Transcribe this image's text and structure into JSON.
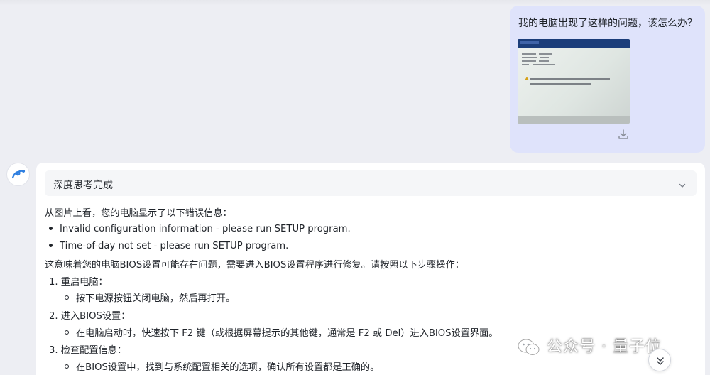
{
  "user_message": {
    "text": "我的电脑出现了这样的问题，该怎么办？",
    "attachment_icon": "photo-of-bios-error-screen",
    "download_icon": "download-icon"
  },
  "assistant": {
    "avatar_icon": "assistant-logo-icon",
    "think_header": "深度思考完成",
    "think_toggle_icon": "chevron-down-icon",
    "intro": "从图片上看，您的电脑显示了以下错误信息：",
    "errors": [
      "Invalid configuration information - please run SETUP program.",
      "Time-of-day not set - please run SETUP program."
    ],
    "summary": "这意味着您的电脑BIOS设置可能存在问题，需要进入BIOS设置程序进行修复。请按照以下步骤操作：",
    "steps": [
      {
        "title": "1. 重启电脑：",
        "detail": "按下电源按钮关闭电脑，然后再打开。"
      },
      {
        "title": "2. 进入BIOS设置：",
        "detail": "在电脑启动时，快速按下 F2 键（或根据屏幕提示的其他键，通常是 F2 或 Del）进入BIOS设置界面。"
      },
      {
        "title": "3. 检查配置信息：",
        "detail": "在BIOS设置中，找到与系统配置相关的选项，确认所有设置都是正确的。"
      }
    ]
  },
  "watermark": {
    "text": "公众号 · 量子位",
    "icon": "wechat-icon"
  },
  "scroll_button_icon": "double-chevron-down-icon",
  "colors": {
    "page_bg": "#edeef3",
    "user_bubble": "#dfe3fb",
    "card_bg": "#ffffff",
    "think_bg": "#f5f6f8",
    "accent": "#2f7fe0"
  }
}
